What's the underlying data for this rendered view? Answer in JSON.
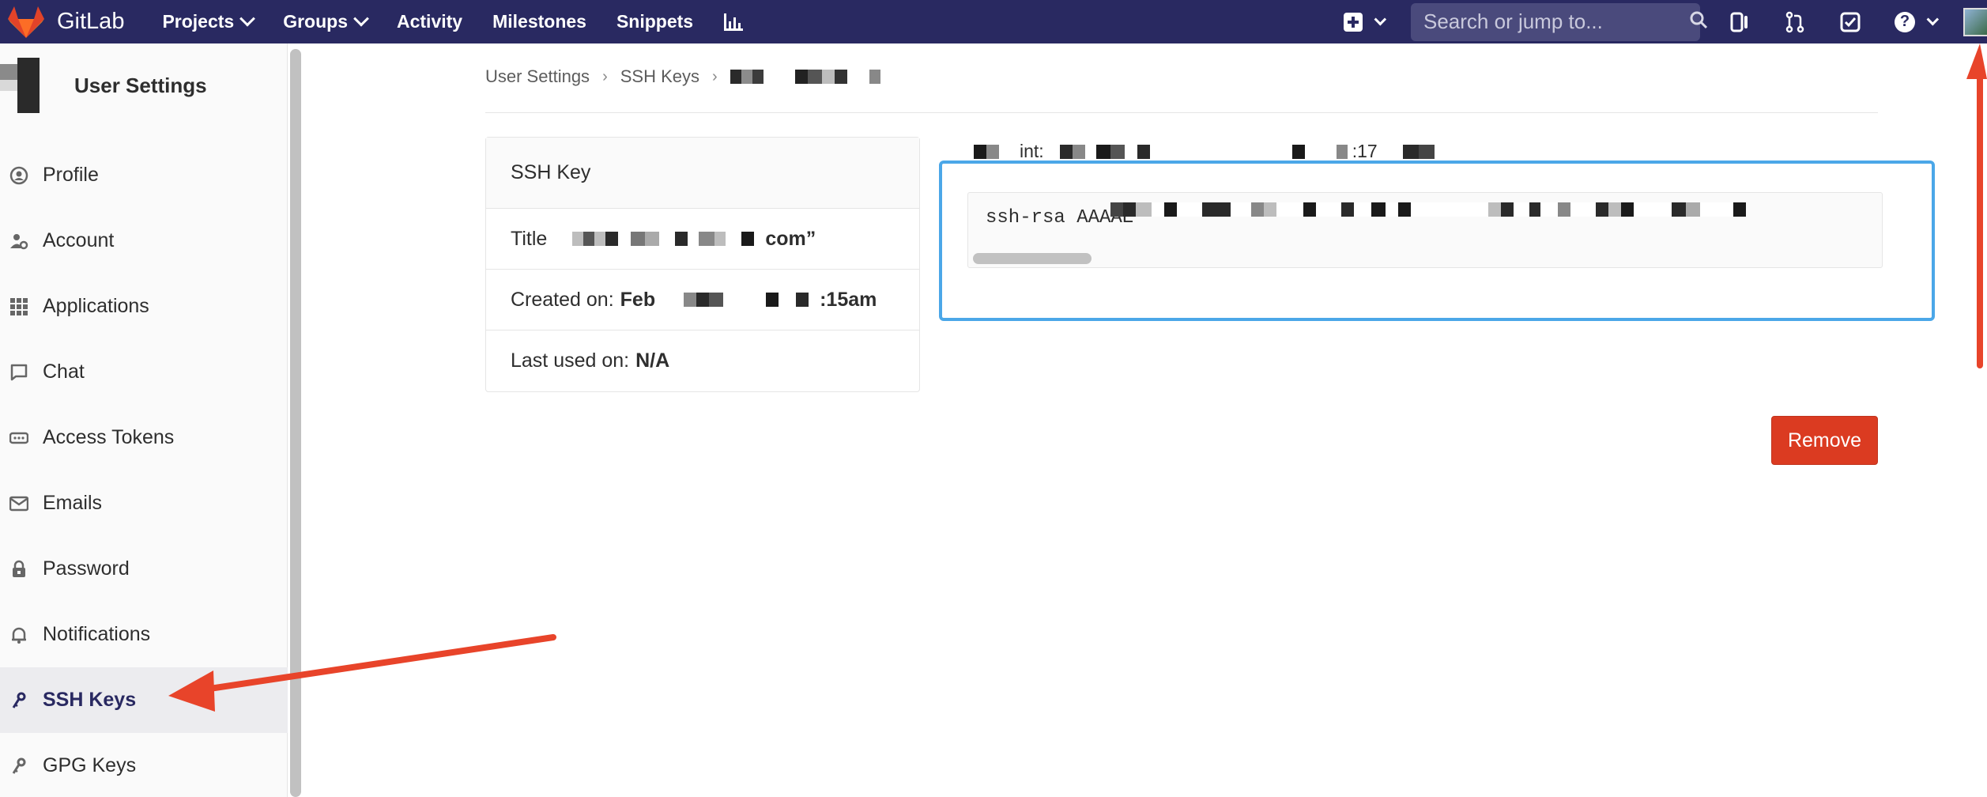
{
  "navbar": {
    "brand": "GitLab",
    "items": [
      {
        "label": "Projects",
        "dropdown": true
      },
      {
        "label": "Groups",
        "dropdown": true
      },
      {
        "label": "Activity",
        "dropdown": false
      },
      {
        "label": "Milestones",
        "dropdown": false
      },
      {
        "label": "Snippets",
        "dropdown": false
      }
    ],
    "search_placeholder": "Search or jump to...",
    "colors": {
      "background": "#292961",
      "search": "#4a4a7c"
    }
  },
  "sidebar": {
    "title": "User Settings",
    "items": [
      {
        "label": "Profile",
        "icon": "profile-icon"
      },
      {
        "label": "Account",
        "icon": "account-gear-icon"
      },
      {
        "label": "Applications",
        "icon": "applications-grid-icon"
      },
      {
        "label": "Chat",
        "icon": "chat-icon"
      },
      {
        "label": "Access Tokens",
        "icon": "token-icon"
      },
      {
        "label": "Emails",
        "icon": "mail-icon"
      },
      {
        "label": "Password",
        "icon": "lock-icon"
      },
      {
        "label": "Notifications",
        "icon": "bell-icon"
      },
      {
        "label": "SSH Keys",
        "icon": "key-icon",
        "active": true
      },
      {
        "label": "GPG Keys",
        "icon": "key-icon"
      }
    ]
  },
  "breadcrumb": {
    "items": [
      "User Settings",
      "SSH Keys"
    ]
  },
  "key_card": {
    "header": "SSH Key",
    "title_label": "Title",
    "title_value_suffix": "com”",
    "created_label": "Created on:",
    "created_value_prefix": "Feb",
    "created_value_suffix": ":15am",
    "last_used_label": "Last used on:",
    "last_used_value": "N/A"
  },
  "fingerprint": {
    "label_fragment": "int:",
    "value_fragment": ":17"
  },
  "key_box": {
    "text": "ssh-rsa AAAAE",
    "border_color": "#4ba7e8"
  },
  "actions": {
    "remove_label": "Remove",
    "remove_color": "#db3b21"
  }
}
